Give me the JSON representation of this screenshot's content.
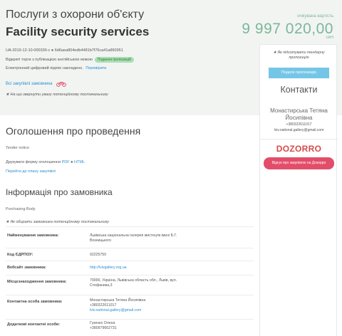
{
  "header": {
    "title_ua": "Послуги з охорони об'єкту",
    "title_en": "Facility security services",
    "expected_label": "очікувана вартість",
    "expected_value": "9 997 020,00",
    "currency": "UAH",
    "identifier": "UA-2019-12-10-000336-c ● 6d6aea804edb4481b7f76ca41a860951",
    "open_bids_text": "Відкриті торги з публікацією англійською мовою",
    "status_badge": "Подання пропозицій",
    "signature_text": "Електронний цифровий підпис накладено.",
    "verify_link": "Перевірити",
    "all_purchases_link": "Всі закупівлі замовника",
    "warning_text": "На що звернути увагу потенційному постачальнику"
  },
  "sidebar": {
    "warning": "Як підготувати тендерну пропозицію",
    "submit_button": "Подати пропозицію",
    "contacts_title": "Контакти",
    "contact_name": "Монастирська Тетяна Йосипівна",
    "contact_phone": "+380322611017",
    "contact_email": "lviv.national.gallery@gmail.com",
    "logo_text": "DOZORRO",
    "dozorro_button": "Відгук про закупівлю на Дозорро"
  },
  "notice": {
    "heading": "Оголошення про проведення",
    "subtitle": "Tender notice",
    "print_text": "Друкувати форму оголошення",
    "print_pdf": "PDF",
    "print_sep": "●",
    "print_html": "HTML",
    "plan_link": "Перейти до плану закупівлі"
  },
  "buyer": {
    "heading": "Інформація про замовника",
    "subtitle": "Purchasing Body",
    "warning": "Як обирати замовника потенційному постачальнику",
    "rows": [
      {
        "label": "Найменування замовника:",
        "value": "Львівська національна галерея мистецтв імені Б.Г. Возницького"
      },
      {
        "label": "Код ЄДРПОУ:",
        "value": "02225750"
      },
      {
        "label": "Вебсайт замовника:",
        "value": "http://lvivgallery.org.ua"
      },
      {
        "label": "Місцезнаходження замовника:",
        "value": "79000, Україна, Львівська область обл., Львів, вул. Стефаника,3"
      },
      {
        "label": "Контактна особа замовника:",
        "value": "Монастирська Тетяна Йосипівна",
        "phone": "+380322611017",
        "email": "lviv.national.gallery@gmail.com"
      },
      {
        "label": "Додаткові контактні особи:",
        "value": "Гузенко Олена",
        "phone": "+380979662731"
      }
    ]
  },
  "colors": {
    "accent_green": "#7ab89a",
    "link_blue": "#2b8fd1",
    "button_blue": "#74c6e7",
    "dozorro_red": "#e24e6a"
  }
}
